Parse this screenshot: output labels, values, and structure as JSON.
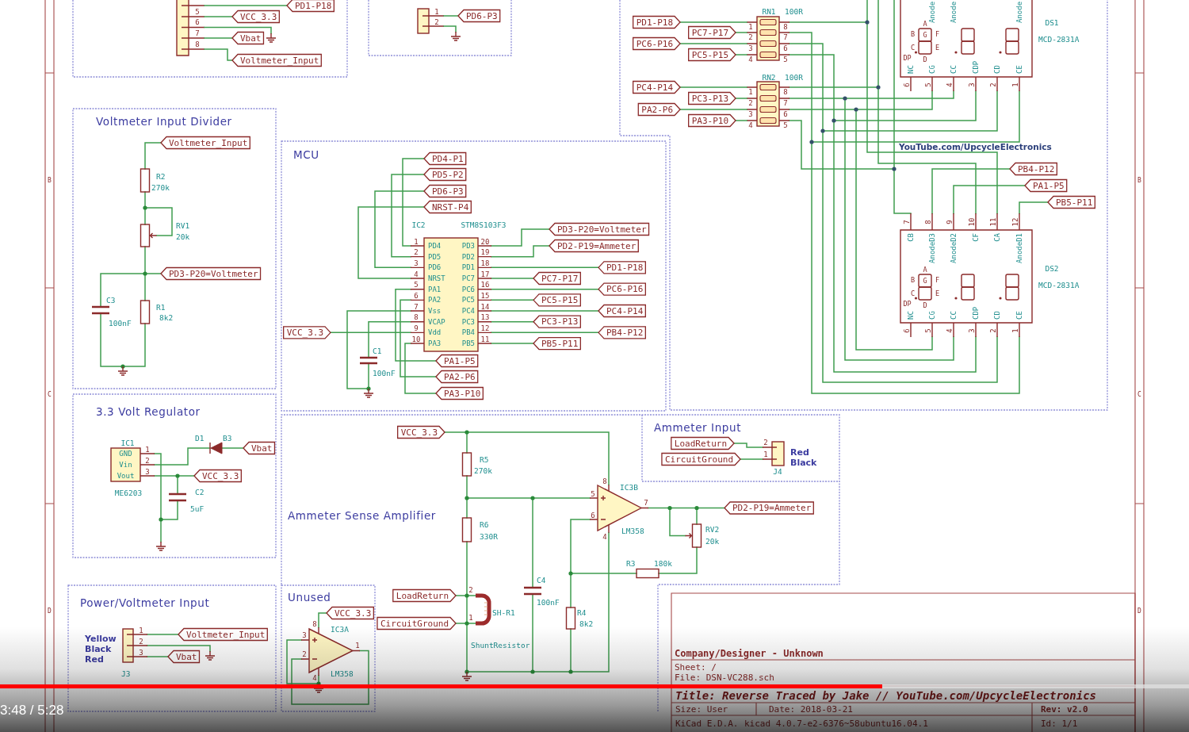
{
  "sheet": {
    "row_letters_left": [
      "B",
      "C",
      "D"
    ],
    "row_letters_right": [
      "B",
      "C",
      "D"
    ]
  },
  "header_connector": {
    "pins": [
      "5",
      "6",
      "7",
      "8"
    ],
    "net_labels": [
      "PD1-P18",
      "VCC_3.3",
      "Vbat",
      "Voltmeter_Input"
    ]
  },
  "jumper": {
    "pins": [
      "1",
      "2"
    ],
    "net_labels": [
      "PD6-P3"
    ]
  },
  "display": {
    "networks": [
      {
        "ref": "RN1",
        "value": "100R",
        "left_pins": [
          "1",
          "2",
          "3",
          "4"
        ],
        "right_pins": [
          "8",
          "7",
          "6",
          "5"
        ]
      },
      {
        "ref": "RN2",
        "value": "100R",
        "left_pins": [
          "1",
          "2",
          "3",
          "4"
        ],
        "right_pins": [
          "8",
          "7",
          "6",
          "5"
        ]
      }
    ],
    "left_labels": [
      "PD1-P18",
      "PC7-P17",
      "PC6-P16",
      "PC5-P15",
      "PC4-P14",
      "PC3-P13",
      "PA2-P6",
      "PA3-P10"
    ],
    "credit": "YouTube.com/UpcycleElectronics",
    "right_labels": [
      "PB4-P12",
      "PA1-P5",
      "PB5-P11"
    ],
    "units": [
      {
        "ref": "DS1",
        "value": "MCD-2831A",
        "top_pin_names": [
          "Anode",
          "Anode",
          "Anode"
        ],
        "bottom_pins": [
          {
            "number": "6",
            "name": "NC"
          },
          {
            "number": "5",
            "name": "CG"
          },
          {
            "number": "4",
            "name": "CC"
          },
          {
            "number": "3",
            "name": "CDP"
          },
          {
            "number": "2",
            "name": "CD"
          },
          {
            "number": "1",
            "name": "CE"
          }
        ],
        "segment_letters": [
          "A",
          "B",
          "G",
          "F",
          "C",
          "E",
          "DP",
          "D"
        ]
      },
      {
        "ref": "DS2",
        "value": "MCD-2831A",
        "top_pins": [
          {
            "number": "7",
            "name": "CB"
          },
          {
            "number": "8",
            "name": "AnodeD3"
          },
          {
            "number": "9",
            "name": "AnodeD2"
          },
          {
            "number": "10",
            "name": "CF"
          },
          {
            "number": "11",
            "name": "CA"
          },
          {
            "number": "12",
            "name": "AnodeD1"
          }
        ],
        "bottom_pins": [
          {
            "number": "6",
            "name": "NC"
          },
          {
            "number": "5",
            "name": "CG"
          },
          {
            "number": "4",
            "name": "CC"
          },
          {
            "number": "3",
            "name": "CDP"
          },
          {
            "number": "2",
            "name": "CD"
          },
          {
            "number": "1",
            "name": "CE"
          }
        ],
        "segment_letters": [
          "A",
          "B",
          "G",
          "F",
          "C",
          "E",
          "DP",
          "D"
        ]
      }
    ]
  },
  "voltmeter_divider": {
    "title": "Voltmeter Input Divider",
    "net_labels": [
      "Voltmeter_Input",
      "PD3-P20=Voltmeter"
    ],
    "parts": [
      {
        "kind": "resistor",
        "ref": "R2",
        "value": "270k"
      },
      {
        "kind": "potentiometer",
        "ref": "RV1",
        "value": "20k"
      },
      {
        "kind": "capacitor",
        "ref": "C3",
        "value": "100nF"
      },
      {
        "kind": "resistor",
        "ref": "R1",
        "value": "8k2"
      }
    ]
  },
  "mcu": {
    "title": "MCU",
    "chip": {
      "ref": "IC2",
      "value": "STM8S103F3",
      "left_pins": [
        {
          "number": "1",
          "name": "PD4"
        },
        {
          "number": "2",
          "name": "PD5"
        },
        {
          "number": "3",
          "name": "PD6"
        },
        {
          "number": "4",
          "name": "NRST"
        },
        {
          "number": "5",
          "name": "PA1"
        },
        {
          "number": "6",
          "name": "PA2"
        },
        {
          "number": "7",
          "name": "Vss"
        },
        {
          "number": "8",
          "name": "VCAP"
        },
        {
          "number": "9",
          "name": "Vdd"
        },
        {
          "number": "10",
          "name": "PA3"
        }
      ],
      "right_pins": [
        {
          "number": "20",
          "name": "PD3"
        },
        {
          "number": "19",
          "name": "PD2"
        },
        {
          "number": "18",
          "name": "PD1"
        },
        {
          "number": "17",
          "name": "PC7"
        },
        {
          "number": "16",
          "name": "PC6"
        },
        {
          "number": "15",
          "name": "PC5"
        },
        {
          "number": "14",
          "name": "PC4"
        },
        {
          "number": "13",
          "name": "PC3"
        },
        {
          "number": "12",
          "name": "PB4"
        },
        {
          "number": "11",
          "name": "PB5"
        }
      ]
    },
    "top_labels": [
      "PD4-P1",
      "PD5-P2",
      "PD6-P3",
      "NRST-P4"
    ],
    "right_labels": [
      "PD3-P20=Voltmeter",
      "PD2-P19=Ammeter",
      "PD1-P18",
      "PC7-P17",
      "PC6-P16",
      "PC5-P15",
      "PC4-P14",
      "PC3-P13",
      "PB4-P12",
      "PB5-P11"
    ],
    "bottom_labels": [
      "PA1-P5",
      "PA2-P6",
      "PA3-P10"
    ],
    "supply_label": "VCC_3.3",
    "capacitor": {
      "ref": "C1",
      "value": "100nF"
    }
  },
  "regulator": {
    "title": "3.3 Volt Regulator",
    "chip": {
      "ref": "IC1",
      "value": "ME6203",
      "pins": [
        {
          "number": "1",
          "name": "GND"
        },
        {
          "number": "2",
          "name": "Vin"
        },
        {
          "number": "3",
          "name": "Vout"
        }
      ]
    },
    "diode": {
      "ref": "D1",
      "value": "B3"
    },
    "capacitor": {
      "ref": "C2",
      "value": "5uF"
    },
    "net_labels": [
      "Vbat",
      "VCC_3.3"
    ]
  },
  "ammeter_amp": {
    "title": "Ammeter Sense Amplifier",
    "net_labels": [
      "VCC_3.3",
      "LoadReturn",
      "CircuitGround",
      "PD2-P19=Ammeter"
    ],
    "parts": [
      {
        "kind": "resistor",
        "ref": "R5",
        "value": "270k"
      },
      {
        "kind": "resistor",
        "ref": "R6",
        "value": "330R"
      },
      {
        "kind": "shunt",
        "ref": "SH-R1",
        "value": "ShuntResistor",
        "pins": [
          "2",
          "1"
        ]
      },
      {
        "kind": "capacitor",
        "ref": "C4",
        "value": "100nF"
      },
      {
        "kind": "resistor",
        "ref": "R4",
        "value": "8k2"
      },
      {
        "kind": "resistor",
        "ref": "R3",
        "value": "180k"
      },
      {
        "kind": "potentiometer",
        "ref": "RV2",
        "value": "20k"
      }
    ],
    "op_amp": {
      "ref": "IC3B",
      "value": "LM358",
      "pins": [
        "5",
        "6",
        "7",
        "8",
        "4"
      ]
    }
  },
  "ammeter_input": {
    "title": "Ammeter Input",
    "net_labels": [
      "LoadReturn",
      "CircuitGround"
    ],
    "connector": {
      "ref": "J4",
      "pins": [
        "2",
        "1"
      ],
      "lead_names": [
        "Red",
        "Black"
      ]
    }
  },
  "power_input": {
    "title": "Power/Voltmeter Input",
    "connector": {
      "ref": "J3",
      "pins": [
        "1",
        "2",
        "3"
      ],
      "lead_names": [
        "Yellow",
        "Black",
        "Red"
      ]
    },
    "net_labels": [
      "Voltmeter_Input",
      "Vbat"
    ]
  },
  "unused": {
    "title": "Unused",
    "net_labels": [
      "VCC_3.3"
    ],
    "op_amp": {
      "ref": "IC3A",
      "value": "LM358",
      "pins": [
        "3",
        "2",
        "1",
        "8",
        "4"
      ]
    }
  },
  "title_block": {
    "company": "Company/Designer - Unknown",
    "sheet": "Sheet: /",
    "file": "File: DSN-VC288.sch",
    "title": "Title: Reverse Traced by Jake // YouTube.com/UpcycleElectronics",
    "size": "Size: User",
    "date": "Date: 2018-03-21",
    "rev": "Rev: v2.0",
    "tool": "KiCad E.D.A.",
    "version": "kicad 4.0.7-e2-6376~58ubuntu16.04.1",
    "id": "Id: 1/1"
  },
  "player": {
    "time": "3:48 / 5:28",
    "level": 0.742
  }
}
